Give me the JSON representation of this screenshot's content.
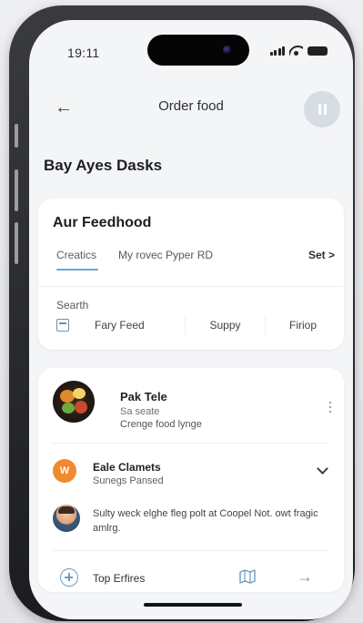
{
  "status_bar": {
    "time": "19:11"
  },
  "header": {
    "title": "Order food"
  },
  "section_title": "Bay Ayes Dasks",
  "feed_card": {
    "title": "Aur Feedhood",
    "tabs": [
      "Creatics",
      "My rovec Pyper RD"
    ],
    "set_label": "Set >",
    "search_label": "Searth",
    "filters": [
      "Fary Feed",
      "Suppy",
      "Firiop"
    ]
  },
  "orders_card": {
    "item1": {
      "title": "Pak Tele",
      "subtitle": "Sa seate",
      "description": "Crenge food lynge"
    },
    "item2": {
      "icon_letter": "W",
      "title": "Eale Clamets",
      "subtitle": "Sunegs Pansed"
    },
    "message": "Sulty weck elghe fleg polt at Coopel Not. owt fragic amlrg.",
    "footer": {
      "add_label": "Top Erfires"
    }
  },
  "colors": {
    "accent": "#6ba4d6",
    "orange": "#f08a2e",
    "pause_button_bg": "#d6dde4"
  },
  "icons": {
    "back": "arrow-left-icon",
    "pause": "pause-icon",
    "calendar": "calendar-icon",
    "more": "more-vertical-icon",
    "chevron": "chevron-down-icon",
    "add": "plus-circle-icon",
    "map": "map-icon",
    "next": "arrow-right-icon"
  }
}
